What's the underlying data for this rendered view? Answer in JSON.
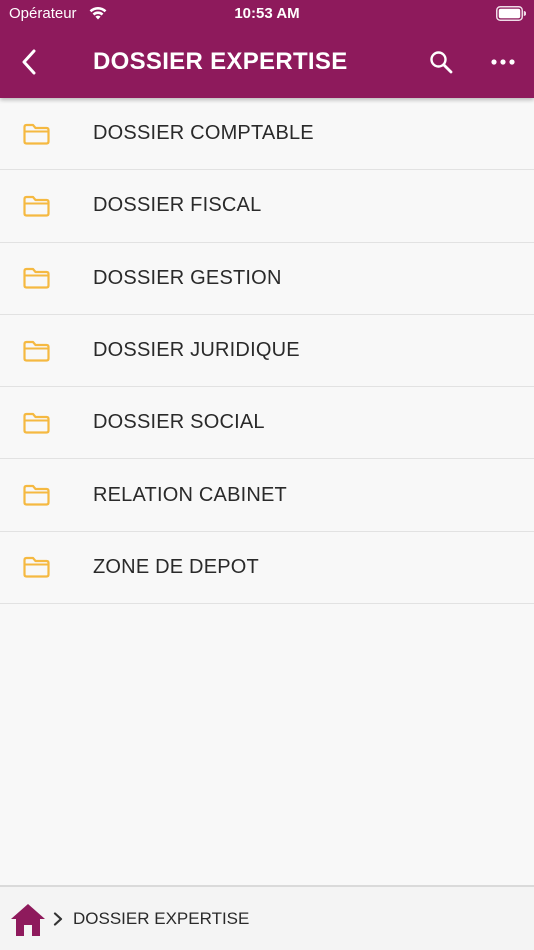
{
  "status_bar": {
    "carrier": "Opérateur",
    "time": "10:53 AM",
    "icons": [
      "wifi-icon",
      "battery-icon"
    ]
  },
  "nav_bar": {
    "title": "DOSSIER EXPERTISE",
    "icons": [
      "chevron-left-icon",
      "search-icon",
      "more-horizontal-icon"
    ]
  },
  "folders": [
    {
      "label": "DOSSIER COMPTABLE",
      "icon": "folder-icon"
    },
    {
      "label": "DOSSIER FISCAL",
      "icon": "folder-icon"
    },
    {
      "label": "DOSSIER GESTION",
      "icon": "folder-icon"
    },
    {
      "label": "DOSSIER JURIDIQUE",
      "icon": "folder-icon"
    },
    {
      "label": "DOSSIER SOCIAL",
      "icon": "folder-icon"
    },
    {
      "label": "RELATION CABINET",
      "icon": "folder-icon"
    },
    {
      "label": "ZONE DE DEPOT",
      "icon": "folder-icon"
    }
  ],
  "breadcrumb": {
    "home_icon": "home-icon",
    "separator_icon": "chevron-right-icon",
    "current": "DOSSIER EXPERTISE"
  },
  "colors": {
    "primary": "#8e1a5c",
    "folder": "#f5b941",
    "background": "#f8f8f8",
    "text": "#2a2a2a"
  }
}
